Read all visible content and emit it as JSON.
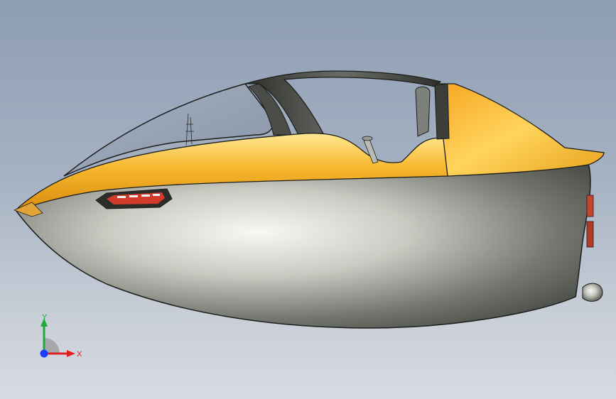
{
  "viewport": {
    "background_top": "#8d9db3",
    "background_bottom": "#d7dbe1"
  },
  "model": {
    "body_colors": {
      "shell_light": "#f5f5f0",
      "shell_dark": "#3f423e",
      "accent_light": "#ffe27a",
      "accent_dark": "#e09a12",
      "canopy_frame": "#3a3a3a",
      "glass": "#9aa7b8"
    }
  },
  "triad": {
    "x_label": "X",
    "y_label": "Y",
    "x_color": "#e02020",
    "y_color": "#1faa3a",
    "z_color": "#1a3cff"
  }
}
